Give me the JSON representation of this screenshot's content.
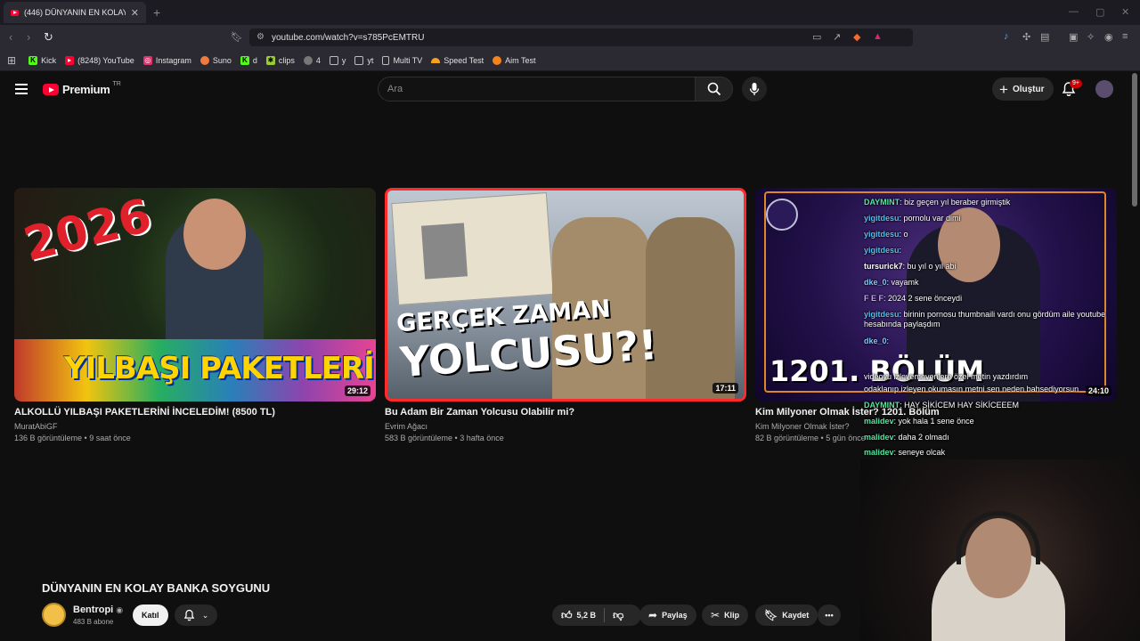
{
  "browser": {
    "tab_title": "(446) DÜNYANIN EN KOLAY BAN",
    "url": "youtube.com/watch?v=s785PcEMTRU",
    "bookmarks": [
      {
        "label": "Kick",
        "color": "#53fc18",
        "icon": "kick-icon"
      },
      {
        "label": "(8248) YouTube",
        "color": "#ff0033",
        "icon": "youtube-icon"
      },
      {
        "label": "Instagram",
        "color": "#e1306c",
        "icon": "instagram-icon"
      },
      {
        "label": "Suno",
        "color": "#f07b3f",
        "icon": "suno-icon"
      },
      {
        "label": "d",
        "color": "#53fc18",
        "icon": "kick-icon"
      },
      {
        "label": "clips",
        "color": "#9acd32",
        "icon": "clips-icon"
      },
      {
        "label": "4",
        "color": "#bbbbbb",
        "icon": "globe-icon"
      },
      {
        "label": "y",
        "color": "#bbbbbb",
        "icon": "folder-icon"
      },
      {
        "label": "yt",
        "color": "#bbbbbb",
        "icon": "folder-icon"
      },
      {
        "label": "Multi TV",
        "color": "#bbbbbb",
        "icon": "page-icon"
      },
      {
        "label": "Speed Test",
        "color": "#f6a21e",
        "icon": "speedtest-icon"
      },
      {
        "label": "Aim Test",
        "color": "#f6821e",
        "icon": "aimtest-icon"
      }
    ]
  },
  "header": {
    "logo_text": "Premium",
    "region": "TR",
    "search_placeholder": "Ara",
    "create_label": "Oluştur",
    "notif_count": "9+"
  },
  "videos": [
    {
      "title": "ALKOLLÜ YILBAŞI PAKETLERİNİ İNCELEDİM! (8500 TL)",
      "channel": "MuratAbiGF",
      "meta": "136 B görüntüleme • 9 saat önce",
      "duration": "29:12",
      "thumb_big": "2026",
      "thumb_caption": "YILBAŞI PAKETLERİ"
    },
    {
      "title": "Bu Adam Bir Zaman Yolcusu Olabilir mi?",
      "channel": "Evrim Ağacı",
      "meta": "583 B görüntüleme • 3 hafta önce",
      "duration": "17:11",
      "thumb_line1": "GERÇEK ZAMAN",
      "thumb_line2": "YOLCUSU?!"
    },
    {
      "title": "Kim Milyoner Olmak İster? 1201. Bölüm",
      "channel": "Kim Milyoner Olmak İster?",
      "meta": "82 B görüntüleme • 5 gün önce",
      "duration": "24:10",
      "thumb_caption": "1201. BÖLÜM"
    }
  ],
  "player": {
    "title": "DÜNYANIN EN KOLAY BANKA SOYGUNU",
    "channel": "Bentropi",
    "subs": "483 B abone",
    "join": "Katıl",
    "likes": "5,2 B",
    "share": "Paylaş",
    "clip": "Klip",
    "save": "Kaydet"
  },
  "chat": [
    {
      "user": "DAYMINT",
      "msg": ": biz geçen yıl beraber girmiştik",
      "color": "#54e6a0"
    },
    {
      "user": "yigitdesu",
      "msg": ": pornolu var dimi",
      "color": "#4fc3f7"
    },
    {
      "user": "yigitdesu",
      "msg": ": o",
      "color": "#4fc3f7"
    },
    {
      "user": "yigitdesu",
      "msg": ":",
      "color": "#4fc3f7"
    },
    {
      "user": "tursurick7",
      "msg": ": bu yıl o yıl abi",
      "color": "#ffffff"
    },
    {
      "user": "dke_0",
      "msg": ": vayamk",
      "color": "#7ec8ff"
    },
    {
      "user": "F E F",
      "msg": ": 2024 2 sene önceydi",
      "color": "#c8a2ff"
    },
    {
      "user": "yigitdesu",
      "msg": ": birinin pornosu thumbnaili vardı onu gördüm aile youtube hesabında paylaşdım",
      "color": "#4fc3f7"
    },
    {
      "user": "dke_0",
      "msg": ":",
      "color": "#7ec8ff"
    },
    {
      "user": "",
      "msg": "videoyu izleyemeyenlere özel metin yazdırdım",
      "color": "#ffffff"
    },
    {
      "user": "",
      "msg": "odaklanıp izleyen okumasın metni sen neden bahsediyorsun",
      "color": "#ffffff"
    },
    {
      "user": "DAYMINT",
      "msg": ": HAY SİKİCEM HAY SİKİCEEEM",
      "color": "#54e6a0"
    },
    {
      "user": "malidev",
      "msg": ": yok hala 1 sene önce",
      "color": "#54e6a0"
    },
    {
      "user": "malidev",
      "msg": ": daha 2 olmadı",
      "color": "#54e6a0"
    },
    {
      "user": "malidev",
      "msg": ": seneye olcak",
      "color": "#54e6a0"
    }
  ]
}
